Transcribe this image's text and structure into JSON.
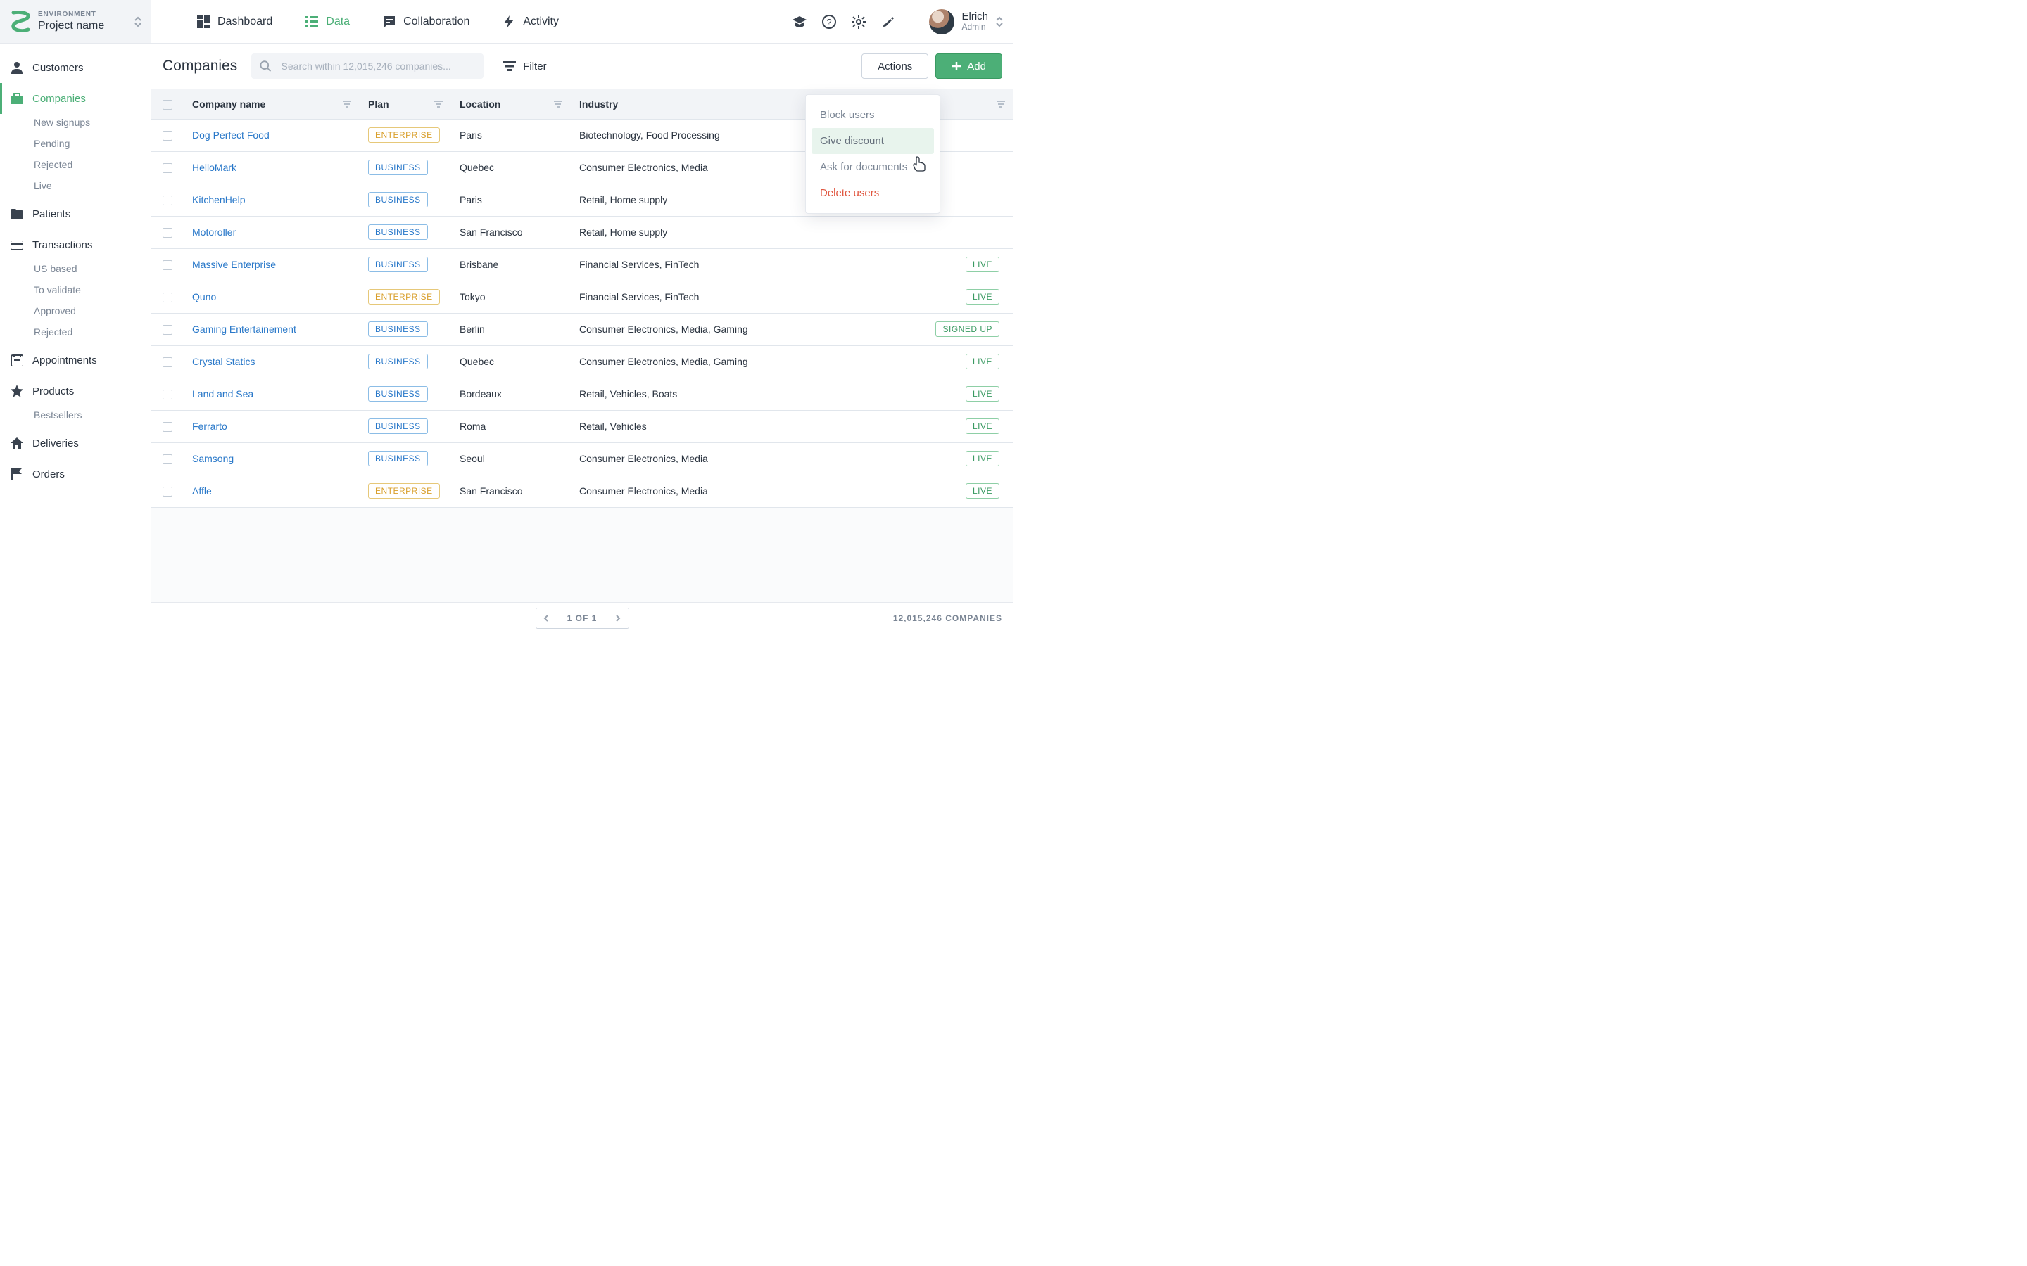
{
  "header": {
    "env_label": "ENVIRONMENT",
    "project": "Project name",
    "user_name": "Elrich",
    "user_role": "Admin"
  },
  "top_tabs": {
    "dashboard": "Dashboard",
    "data": "Data",
    "collaboration": "Collaboration",
    "activity": "Activity"
  },
  "sidebar": {
    "customers": {
      "label": "Customers",
      "subs": []
    },
    "companies": {
      "label": "Companies",
      "subs": [
        "New signups",
        "Pending",
        "Rejected",
        "Live"
      ]
    },
    "patients": {
      "label": "Patients",
      "subs": []
    },
    "transactions": {
      "label": "Transactions",
      "subs": [
        "US based",
        "To validate",
        "Approved",
        "Rejected"
      ]
    },
    "appointments": {
      "label": "Appointments",
      "subs": []
    },
    "products": {
      "label": "Products",
      "subs": [
        "Bestsellers"
      ]
    },
    "deliveries": {
      "label": "Deliveries",
      "subs": []
    },
    "orders": {
      "label": "Orders",
      "subs": []
    }
  },
  "main": {
    "title": "Companies",
    "search_placeholder": "Search within 12,015,246 companies...",
    "filter_label": "Filter",
    "actions_label": "Actions",
    "add_label": "Add",
    "columns": [
      "Company name",
      "Plan",
      "Location",
      "Industry",
      ""
    ],
    "pager_label": "1 OF 1",
    "footer_count": "12,015,246 COMPANIES"
  },
  "actions_menu": {
    "block": "Block users",
    "discount": "Give discount",
    "ask": "Ask for documents",
    "delete": "Delete users"
  },
  "rows": [
    {
      "name": "Dog Perfect Food",
      "plan": "ENTERPRISE",
      "location": "Paris",
      "industry": "Biotechnology, Food Processing",
      "status": ""
    },
    {
      "name": "HelloMark",
      "plan": "BUSINESS",
      "location": "Quebec",
      "industry": "Consumer Electronics, Media",
      "status": ""
    },
    {
      "name": "KitchenHelp",
      "plan": "BUSINESS",
      "location": "Paris",
      "industry": "Retail, Home supply",
      "status": ""
    },
    {
      "name": "Motoroller",
      "plan": "BUSINESS",
      "location": "San Francisco",
      "industry": "Retail, Home supply",
      "status": ""
    },
    {
      "name": "Massive Enterprise",
      "plan": "BUSINESS",
      "location": "Brisbane",
      "industry": "Financial Services, FinTech",
      "status": "LIVE"
    },
    {
      "name": "Quno",
      "plan": "ENTERPRISE",
      "location": "Tokyo",
      "industry": "Financial Services, FinTech",
      "status": "LIVE"
    },
    {
      "name": "Gaming Entertainement",
      "plan": "BUSINESS",
      "location": "Berlin",
      "industry": "Consumer Electronics, Media, Gaming",
      "status": "SIGNED UP"
    },
    {
      "name": "Crystal Statics",
      "plan": "BUSINESS",
      "location": "Quebec",
      "industry": "Consumer Electronics, Media, Gaming",
      "status": "LIVE"
    },
    {
      "name": "Land and Sea",
      "plan": "BUSINESS",
      "location": "Bordeaux",
      "industry": "Retail, Vehicles, Boats",
      "status": "LIVE"
    },
    {
      "name": "Ferrarto",
      "plan": "BUSINESS",
      "location": "Roma",
      "industry": "Retail, Vehicles",
      "status": "LIVE"
    },
    {
      "name": "Samsong",
      "plan": "BUSINESS",
      "location": "Seoul",
      "industry": "Consumer Electronics, Media",
      "status": "LIVE"
    },
    {
      "name": "Affle",
      "plan": "ENTERPRISE",
      "location": "San Francisco",
      "industry": "Consumer Electronics, Media",
      "status": "LIVE"
    }
  ]
}
